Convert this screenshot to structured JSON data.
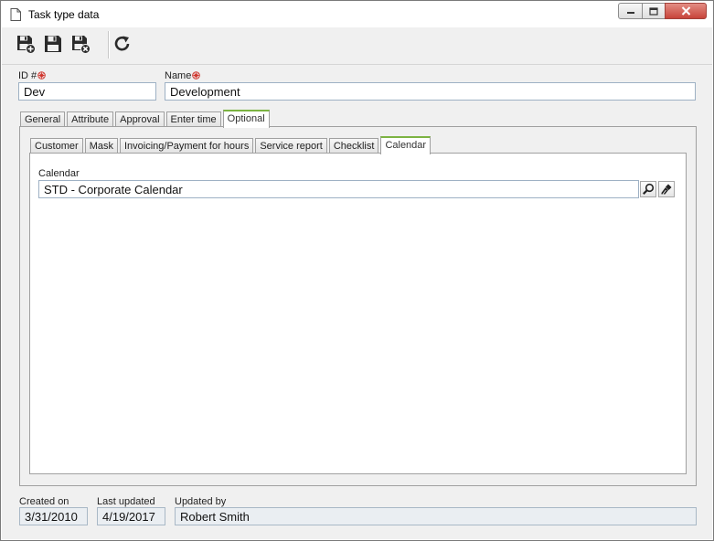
{
  "window": {
    "title": "Task type data"
  },
  "fields": {
    "id_label": "ID #",
    "id_value": "Dev",
    "name_label": "Name",
    "name_value": "Development"
  },
  "outer_tabs": [
    {
      "label": "General"
    },
    {
      "label": "Attribute"
    },
    {
      "label": "Approval"
    },
    {
      "label": "Enter time"
    },
    {
      "label": "Optional"
    }
  ],
  "inner_tabs": [
    {
      "label": "Customer"
    },
    {
      "label": "Mask"
    },
    {
      "label": "Invoicing/Payment for hours"
    },
    {
      "label": "Service report"
    },
    {
      "label": "Checklist"
    },
    {
      "label": "Calendar"
    }
  ],
  "calendar": {
    "label": "Calendar",
    "value": "STD - Corporate Calendar"
  },
  "footer": {
    "created_label": "Created on",
    "created_value": "3/31/2010",
    "updated_label": "Last updated",
    "updated_value": "4/19/2017",
    "updated_by_label": "Updated by",
    "updated_by_value": "Robert Smith"
  },
  "icons": {
    "toolbar": [
      "save-new-icon",
      "save-icon",
      "save-close-icon",
      "refresh-icon"
    ],
    "window": [
      "document-icon",
      "minimize-icon",
      "maximize-icon",
      "close-icon"
    ],
    "calendar": [
      "search-icon",
      "clear-icon"
    ],
    "required": "required-icon"
  },
  "colors": {
    "active_tab_accent": "#7cb342",
    "required_mark": "#d0342c",
    "close_button": "#c8443a"
  }
}
